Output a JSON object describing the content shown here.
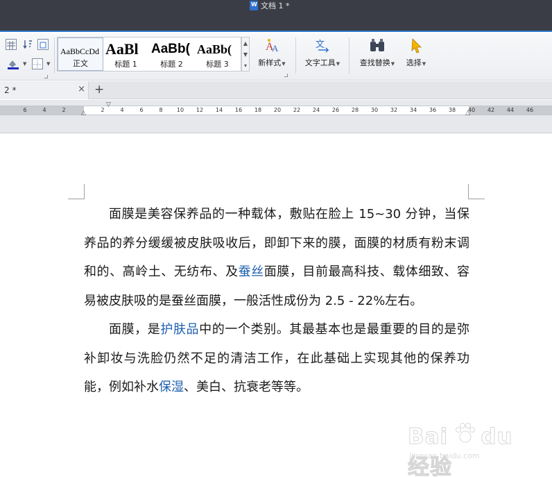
{
  "window": {
    "title": "文档 1 *"
  },
  "ribbon": {
    "styles": [
      {
        "sample": "AaBbCcDd",
        "name": "正文",
        "selected": true
      },
      {
        "sample": "AaBl",
        "name": "标题 1",
        "selected": false
      },
      {
        "sample": "AaBb(",
        "name": "标题 2",
        "selected": false
      },
      {
        "sample": "AaBb(",
        "name": "标题 3",
        "selected": false
      }
    ],
    "new_style_label": "新样式",
    "text_tools_label": "文字工具",
    "find_replace_label": "查找替换",
    "select_label": "选择"
  },
  "tabs": {
    "document_tab_label": "2 *",
    "new_tab": "+",
    "close": "×"
  },
  "ruler": {
    "numbers": [
      "6",
      "4",
      "2",
      "2",
      "4",
      "6",
      "8",
      "10",
      "12",
      "14",
      "16",
      "18",
      "20",
      "22",
      "24",
      "26",
      "28",
      "30",
      "32",
      "34",
      "36",
      "38",
      "40",
      "42",
      "44",
      "46"
    ]
  },
  "document": {
    "paragraphs": [
      {
        "pre": "面膜是美容保养品的一种载体，敷贴在脸上 15~30 分钟，当保养品的养分缓缓被皮肤吸收后，即卸下来的膜，面膜的材质有粉末调和的、高岭土、无纺布、及",
        "link": "蚕丝",
        "post": "面膜，目前最高科技、载体细致、容易被皮肤吸的是蚕丝面膜，一般活性成份为 2.5 - 22%左右。"
      },
      {
        "pre": "面膜，是",
        "link": "护肤品",
        "mid": "中的一个类别。其最基本也是最重要的目的是弥补卸妆与洗脸仍然不足的清洁工作，在此基础上实现其他的保养功能，例如补水",
        "link2": "保湿",
        "post": "、美白、抗衰老等等。"
      }
    ]
  },
  "watermark": {
    "logo": "Bai du 经验",
    "sub": "jingyan.baidu.com"
  },
  "colors": {
    "titlebar": "#3a3d45",
    "accent": "#2f79c9",
    "link": "#1e5fae"
  }
}
